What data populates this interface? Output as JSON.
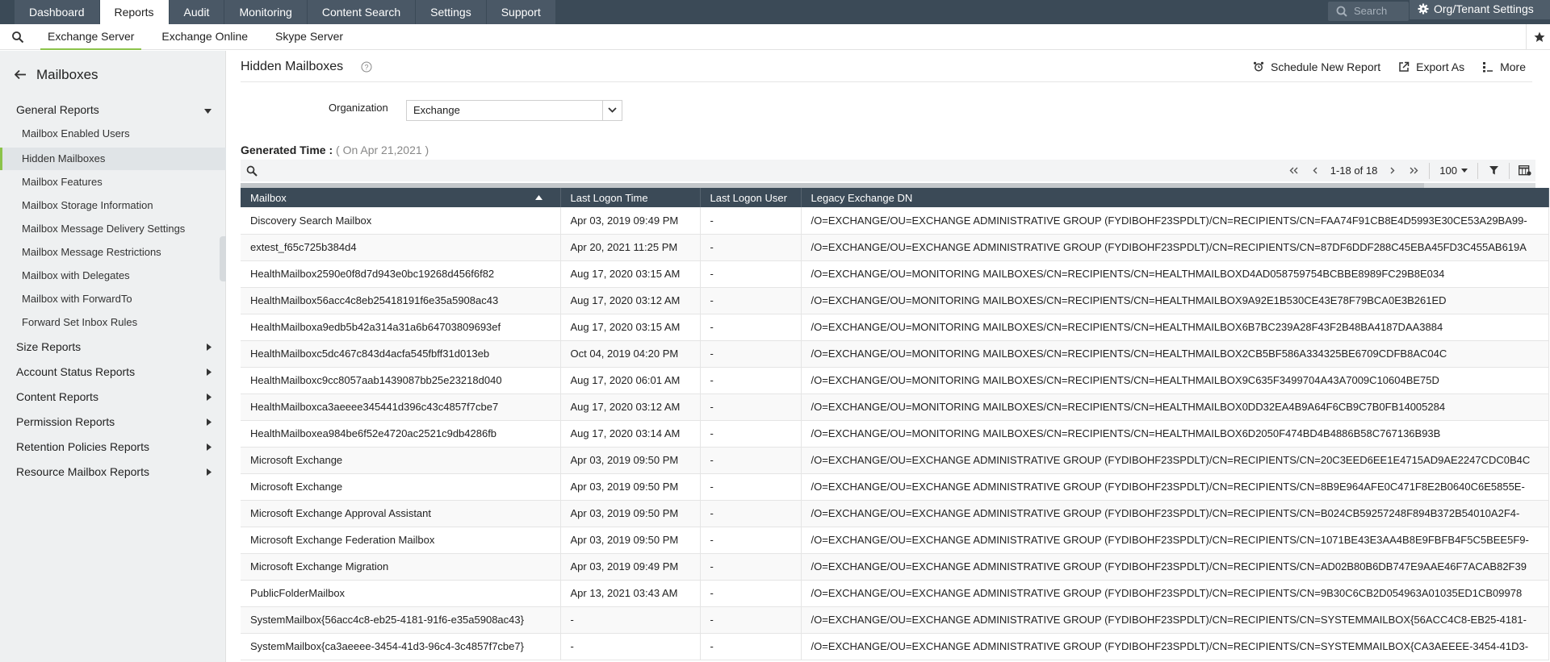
{
  "topnav": {
    "tabs": [
      {
        "label": "Dashboard",
        "active": false
      },
      {
        "label": "Reports",
        "active": true
      },
      {
        "label": "Audit",
        "active": false
      },
      {
        "label": "Monitoring",
        "active": false
      },
      {
        "label": "Content Search",
        "active": false
      },
      {
        "label": "Settings",
        "active": false
      },
      {
        "label": "Support",
        "active": false
      }
    ],
    "search_placeholder": "Search",
    "org_settings_label": "Org/Tenant Settings"
  },
  "subnav": {
    "tabs": [
      {
        "label": "Exchange Server",
        "active": true
      },
      {
        "label": "Exchange Online",
        "active": false
      },
      {
        "label": "Skype Server",
        "active": false
      }
    ]
  },
  "sidebar": {
    "title": "Mailboxes",
    "general_reports": "General Reports",
    "items": [
      "Mailbox Enabled Users",
      "Hidden Mailboxes",
      "Mailbox Features",
      "Mailbox Storage Information",
      "Mailbox Message Delivery Settings",
      "Mailbox Message Restrictions",
      "Mailbox with Delegates",
      "Mailbox with ForwardTo",
      "Forward Set Inbox Rules"
    ],
    "active_item": "Hidden Mailboxes",
    "groups": [
      "Size Reports",
      "Account Status Reports",
      "Content Reports",
      "Permission Reports",
      "Retention Policies Reports",
      "Resource Mailbox Reports"
    ]
  },
  "main": {
    "title": "Hidden Mailboxes",
    "actions": {
      "schedule": "Schedule New Report",
      "export": "Export As",
      "more": "More"
    },
    "org_label": "Organization",
    "org_value": "Exchange",
    "generated_label": "Generated Time :",
    "generated_value": "( On Apr 21,2021 )",
    "pager": {
      "range": "1-18 of 18",
      "page_size": "100"
    },
    "columns": [
      "Mailbox",
      "Last Logon Time",
      "Last Logon User",
      "Legacy Exchange DN"
    ],
    "rows": [
      [
        "Discovery Search Mailbox",
        "Apr 03, 2019 09:49 PM",
        "-",
        "/O=EXCHANGE/OU=EXCHANGE ADMINISTRATIVE GROUP (FYDIBOHF23SPDLT)/CN=RECIPIENTS/CN=FAA74F91CB8E4D5993E30CE53A29BA99-"
      ],
      [
        "extest_f65c725b384d4",
        "Apr 20, 2021 11:25 PM",
        "-",
        "/O=EXCHANGE/OU=EXCHANGE ADMINISTRATIVE GROUP (FYDIBOHF23SPDLT)/CN=RECIPIENTS/CN=87DF6DDF288C45EBA45FD3C455AB619A"
      ],
      [
        "HealthMailbox2590e0f8d7d943e0bc19268d456f6f82",
        "Aug 17, 2020 03:15 AM",
        "-",
        "/O=EXCHANGE/OU=MONITORING MAILBOXES/CN=RECIPIENTS/CN=HEALTHMAILBOXD4AD058759754BCBBE8989FC29B8E034"
      ],
      [
        "HealthMailbox56acc4c8eb25418191f6e35a5908ac43",
        "Aug 17, 2020 03:12 AM",
        "-",
        "/O=EXCHANGE/OU=MONITORING MAILBOXES/CN=RECIPIENTS/CN=HEALTHMAILBOX9A92E1B530CE43E78F79BCA0E3B261ED"
      ],
      [
        "HealthMailboxa9edb5b42a314a31a6b64703809693ef",
        "Aug 17, 2020 03:15 AM",
        "-",
        "/O=EXCHANGE/OU=MONITORING MAILBOXES/CN=RECIPIENTS/CN=HEALTHMAILBOX6B7BC239A28F43F2B48BA4187DAA3884"
      ],
      [
        "HealthMailboxc5dc467c843d4acfa545fbff31d013eb",
        "Oct 04, 2019 04:20 PM",
        "-",
        "/O=EXCHANGE/OU=MONITORING MAILBOXES/CN=RECIPIENTS/CN=HEALTHMAILBOX2CB5BF586A334325BE6709CDFB8AC04C"
      ],
      [
        "HealthMailboxc9cc8057aab1439087bb25e23218d040",
        "Aug 17, 2020 06:01 AM",
        "-",
        "/O=EXCHANGE/OU=MONITORING MAILBOXES/CN=RECIPIENTS/CN=HEALTHMAILBOX9C635F3499704A43A7009C10604BE75D"
      ],
      [
        "HealthMailboxca3aeeee345441d396c43c4857f7cbe7",
        "Aug 17, 2020 03:12 AM",
        "-",
        "/O=EXCHANGE/OU=MONITORING MAILBOXES/CN=RECIPIENTS/CN=HEALTHMAILBOX0DD32EA4B9A64F6CB9C7B0FB14005284"
      ],
      [
        "HealthMailboxea984be6f52e4720ac2521c9db4286fb",
        "Aug 17, 2020 03:14 AM",
        "-",
        "/O=EXCHANGE/OU=MONITORING MAILBOXES/CN=RECIPIENTS/CN=HEALTHMAILBOX6D2050F474BD4B4886B58C767136B93B"
      ],
      [
        "Microsoft Exchange",
        "Apr 03, 2019 09:50 PM",
        "-",
        "/O=EXCHANGE/OU=EXCHANGE ADMINISTRATIVE GROUP (FYDIBOHF23SPDLT)/CN=RECIPIENTS/CN=20C3EED6EE1E4715AD9AE2247CDC0B4C"
      ],
      [
        "Microsoft Exchange",
        "Apr 03, 2019 09:50 PM",
        "-",
        "/O=EXCHANGE/OU=EXCHANGE ADMINISTRATIVE GROUP (FYDIBOHF23SPDLT)/CN=RECIPIENTS/CN=8B9E964AFE0C471F8E2B0640C6E5855E-"
      ],
      [
        "Microsoft Exchange Approval Assistant",
        "Apr 03, 2019 09:50 PM",
        "-",
        "/O=EXCHANGE/OU=EXCHANGE ADMINISTRATIVE GROUP (FYDIBOHF23SPDLT)/CN=RECIPIENTS/CN=B024CB59257248F894B372B54010A2F4-"
      ],
      [
        "Microsoft Exchange Federation Mailbox",
        "Apr 03, 2019 09:50 PM",
        "-",
        "/O=EXCHANGE/OU=EXCHANGE ADMINISTRATIVE GROUP (FYDIBOHF23SPDLT)/CN=RECIPIENTS/CN=1071BE43E3AA4B8E9FBFB4F5C5BEE5F9-"
      ],
      [
        "Microsoft Exchange Migration",
        "Apr 03, 2019 09:49 PM",
        "-",
        "/O=EXCHANGE/OU=EXCHANGE ADMINISTRATIVE GROUP (FYDIBOHF23SPDLT)/CN=RECIPIENTS/CN=AD02B80B6DB747E9AAE46F7ACAB82F39"
      ],
      [
        "PublicFolderMailbox",
        "Apr 13, 2021 03:43 AM",
        "-",
        "/O=EXCHANGE/OU=EXCHANGE ADMINISTRATIVE GROUP (FYDIBOHF23SPDLT)/CN=RECIPIENTS/CN=9B30C6CB2D054963A01035ED1CB09978"
      ],
      [
        "SystemMailbox{56acc4c8-eb25-4181-91f6-e35a5908ac43}",
        "-",
        "-",
        "/O=EXCHANGE/OU=EXCHANGE ADMINISTRATIVE GROUP (FYDIBOHF23SPDLT)/CN=RECIPIENTS/CN=SYSTEMMAILBOX{56ACC4C8-EB25-4181-"
      ],
      [
        "SystemMailbox{ca3aeeee-3454-41d3-96c4-3c4857f7cbe7}",
        "-",
        "-",
        "/O=EXCHANGE/OU=EXCHANGE ADMINISTRATIVE GROUP (FYDIBOHF23SPDLT)/CN=RECIPIENTS/CN=SYSTEMMAILBOX{CA3AEEEE-3454-41D3-"
      ]
    ]
  },
  "colors": {
    "nav_bg": "#3b4a57",
    "accent": "#8bc34a"
  }
}
